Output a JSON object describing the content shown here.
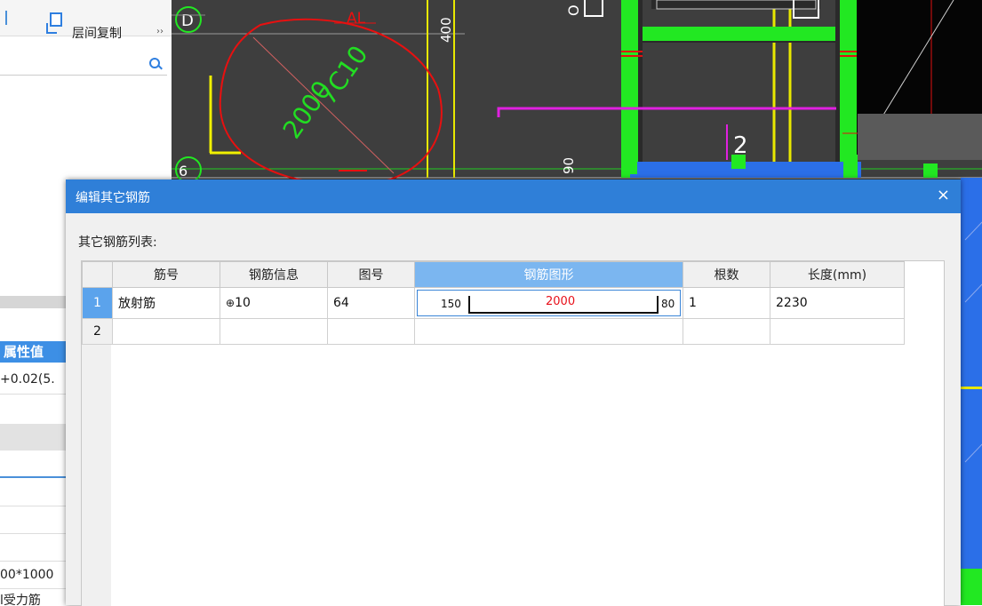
{
  "left_panel": {
    "toolbar": {
      "copy_label": "层间复制",
      "more": "››"
    },
    "props": {
      "header": "属性值",
      "row1": "+0.02(5.",
      "row2": "00*1000",
      "row3": "l受力筋"
    }
  },
  "cad": {
    "axis_d": "D",
    "axis_6": "6",
    "dim_400": "400",
    "label_al": "AL",
    "annot_7c10": "7C10",
    "annot_2000": "2000",
    "label_2": "2",
    "dim_90": "90"
  },
  "dialog": {
    "title": "编辑其它钢筋",
    "close": "×",
    "list_label": "其它钢筋列表:",
    "columns": [
      "筋号",
      "钢筋信息",
      "图号",
      "钢筋图形",
      "根数",
      "长度(mm)"
    ],
    "rows": [
      {
        "num": "1",
        "name": "放射筋",
        "info_symbol": "⊕",
        "info": "10",
        "figure": "64",
        "shape": {
          "left": "150",
          "mid": "2000",
          "right": "80"
        },
        "count": "1",
        "length": "2230"
      },
      {
        "num": "2",
        "name": "",
        "info": "",
        "figure": "",
        "count": "",
        "length": ""
      }
    ]
  },
  "colors": {
    "accent": "#2f7fd8",
    "selected_header": "#7bb6f0",
    "red_text": "#e8101a",
    "cad_green": "#22e822"
  }
}
